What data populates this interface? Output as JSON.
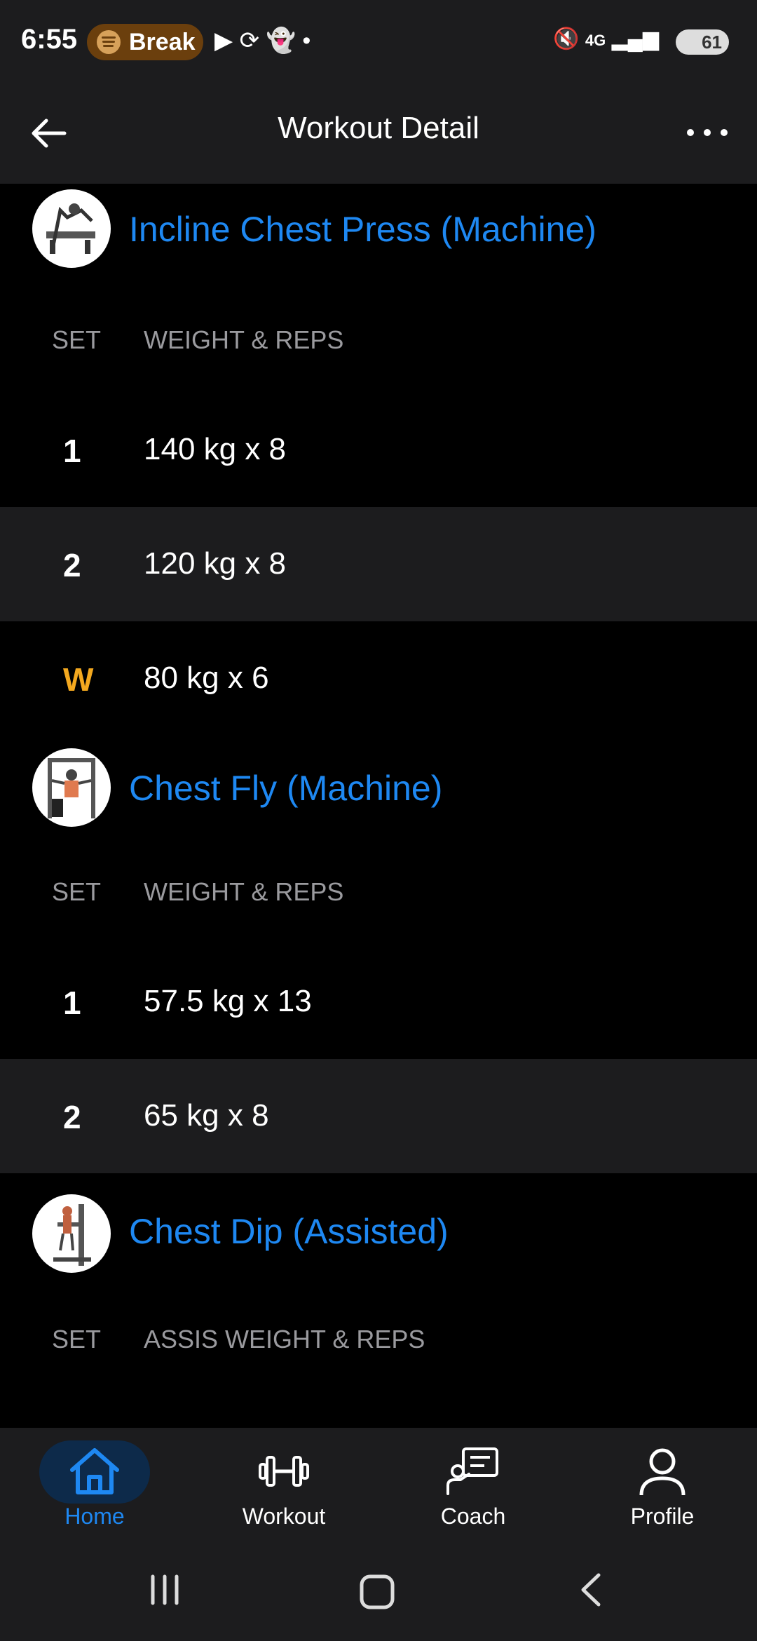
{
  "status_bar": {
    "time": "6:55",
    "break_label": "Break",
    "network": "4G",
    "battery": "61"
  },
  "header": {
    "title": "Workout Detail"
  },
  "exercises": [
    {
      "name": "Incline Chest Press (Machine)",
      "col_set": "SET",
      "col_weight": "WEIGHT & REPS",
      "sets": [
        {
          "set": "1",
          "value": "140 kg x 8"
        },
        {
          "set": "2",
          "value": "120 kg x 8"
        },
        {
          "set": "W",
          "value": "80 kg x 6"
        }
      ]
    },
    {
      "name": "Chest Fly (Machine)",
      "col_set": "SET",
      "col_weight": "WEIGHT & REPS",
      "sets": [
        {
          "set": "1",
          "value": "57.5 kg x 13"
        },
        {
          "set": "2",
          "value": "65 kg x 8"
        }
      ]
    },
    {
      "name": "Chest Dip (Assisted)",
      "col_set": "SET",
      "col_weight": "ASSIS WEIGHT & REPS",
      "sets": []
    }
  ],
  "nav": {
    "home": "Home",
    "workout": "Workout",
    "coach": "Coach",
    "profile": "Profile"
  },
  "colors": {
    "accent": "#1e88f2",
    "warmup": "#f3a81f",
    "surface": "#1c1c1e"
  }
}
